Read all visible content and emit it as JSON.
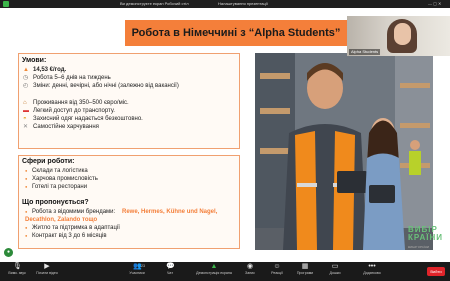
{
  "topbar": {
    "tab1": "Ви демонструєте екран Робочий стіл",
    "tab2": "Налаштування презентації",
    "controls": "— ▢ ✕"
  },
  "slide": {
    "title": "Робота в Німеччині з “Alpha Students”",
    "conditions_heading": "Умови:",
    "pay": "14,53 €/год.",
    "workweek": "Робота 5–6 днів на тиждень",
    "shifts": "Зміни: денні, вечірні, або нічні (залежно від вакансії)",
    "housing": "Проживання від 350–500 євро/міс.",
    "transport": "Легкий доступ до транспорту.",
    "clothing": "Захисний одяг надається безкоштовно.",
    "food": "Самостійне харчування",
    "spheres_heading": "Сфери роботи:",
    "spheres": [
      "Склади та логістика",
      "Харчова промисловість",
      "Готелі та ресторани"
    ],
    "offer_heading": "Що пропонується?",
    "offer_brands_prefix": "Робота з відомими брендами: ",
    "offer_brands_list": "Rewe, Hermes, Kühne und Nagel, Decathlon, Zalando тощо",
    "offer_support": "Житло та підтримка в адаптації",
    "offer_contract": "Контракт від 3 до 6 місяців",
    "brand_mark": "ВИБІР КРАЇНИ",
    "brand_sub": "ВИБІР КРАЇНИ"
  },
  "video": {
    "name": "Alpha Students"
  },
  "meeting_bar": {
    "items": [
      {
        "label": "Вимк. звук",
        "icon": "mic-icon"
      },
      {
        "label": "Почати відео",
        "icon": "camera-icon"
      },
      {
        "label": "Учасники",
        "icon": "participants-icon",
        "count": "23"
      },
      {
        "label": "Чат",
        "icon": "chat-icon"
      },
      {
        "label": "Демонстрація екрана",
        "icon": "share-screen-icon"
      },
      {
        "label": "Запис",
        "icon": "record-icon"
      },
      {
        "label": "Реакції",
        "icon": "reactions-icon"
      },
      {
        "label": "Програми",
        "icon": "apps-icon"
      },
      {
        "label": "Дошки",
        "icon": "whiteboard-icon"
      },
      {
        "label": "Додатково",
        "icon": "more-icon"
      }
    ],
    "end_label": "Вийти"
  },
  "colors": {
    "accent": "#f47f3a",
    "meeting_bar": "#1a1a1a",
    "end_button": "#e0242a",
    "share_green": "#2d8a3a"
  }
}
